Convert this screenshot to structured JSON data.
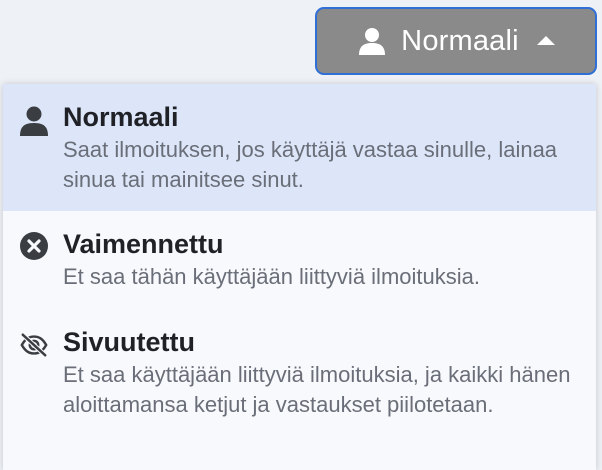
{
  "toggle": {
    "label": "Normaali",
    "icon": "user-icon",
    "caret_icon": "caret-up-icon",
    "background": "#8a8a8a",
    "border": "#2f6fd6"
  },
  "menu": {
    "items": [
      {
        "title": "Normaali",
        "description": "Saat ilmoituksen, jos käyttäjä vastaa sinulle, lainaa sinua tai mainitsee sinut.",
        "icon": "user-icon",
        "selected": true
      },
      {
        "title": "Vaimennettu",
        "description": "Et saa tähän käyttäjään liittyviä ilmoituksia.",
        "icon": "times-circle-icon",
        "selected": false
      },
      {
        "title": "Sivuutettu",
        "description": "Et saa käyttäjään liittyviä ilmoituksia, ja kaikki hänen aloittamansa ketjut ja vastaukset piilotetaan.",
        "icon": "eye-slash-icon",
        "selected": false
      }
    ],
    "selected_bg": "#dce6f8"
  }
}
